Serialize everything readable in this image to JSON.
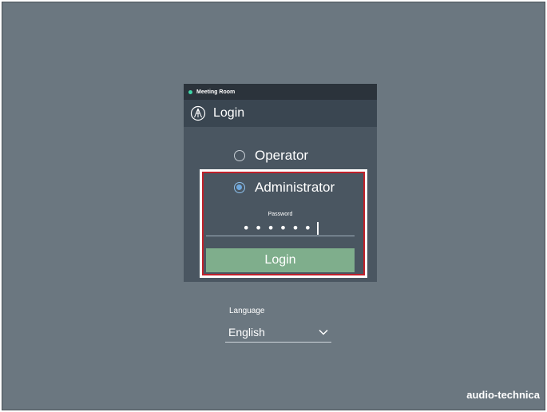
{
  "panel": {
    "room_name": "Meeting Room",
    "title": "Login",
    "brand_icon": "audio-technica-logo-icon",
    "status_color": "#3fd6a8"
  },
  "roles": [
    {
      "label": "Operator",
      "selected": false
    },
    {
      "label": "Administrator",
      "selected": true
    }
  ],
  "password": {
    "label": "Password",
    "masked_value": "••••••"
  },
  "login_button": {
    "label": "Login",
    "color": "#7fae8c"
  },
  "language": {
    "label": "Language",
    "selected": "English",
    "icon": "chevron-down-icon"
  },
  "footer": {
    "brand": "audio-technica"
  },
  "highlight": {
    "color": "#c0202a"
  }
}
